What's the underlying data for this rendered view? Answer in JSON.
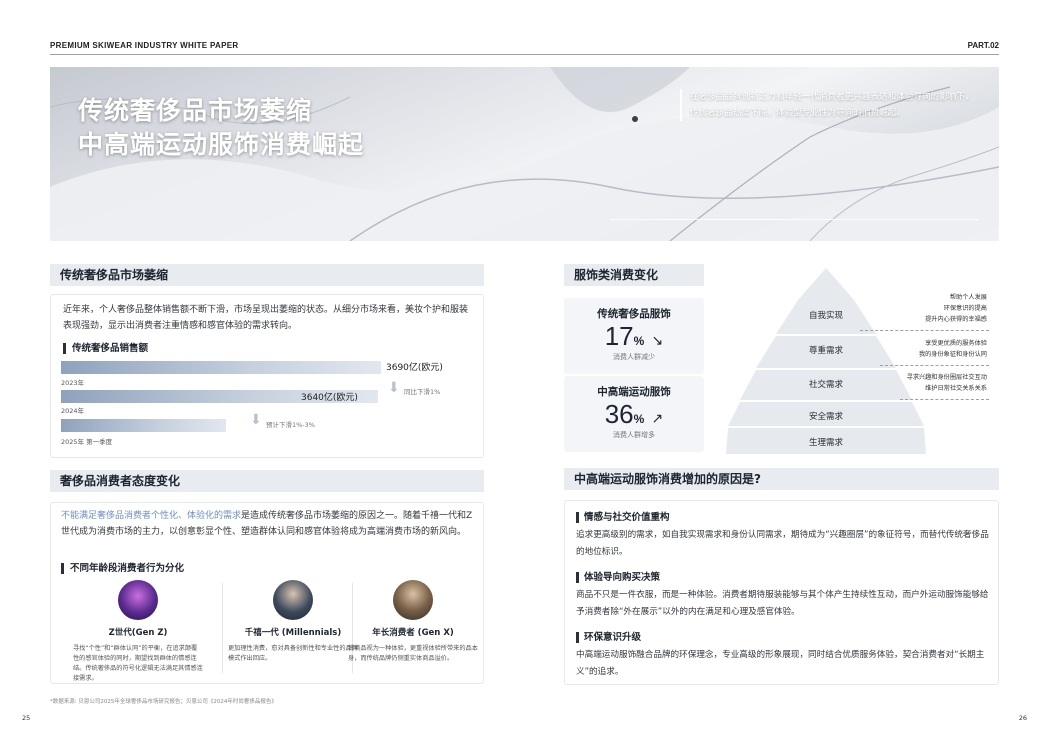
{
  "header": {
    "left": "PREMIUM SKIWEAR INDUSTRY WHITE PAPER",
    "right": "PART.02"
  },
  "hero": {
    "title1": "传统奢侈品市场萎缩",
    "title2": "中高端运动服饰消费崛起",
    "desc": "在奢侈品品牌创新乏力和年轻一代消费者更兴趣表达和体验导向的影响下，传统奢侈品热度下降，体验型专业性为导向的消费崛起。"
  },
  "left_sec1": {
    "title": "传统奢侈品市场萎缩",
    "para": "近年来，个人奢侈品整体销售额不断下滑，市场呈现出萎缩的状态。从细分市场来看，美妆个护和服装表现强劲，显示出消费者注重情感和感官体验的需求转向。",
    "chart_sub": "传统奢侈品销售额"
  },
  "chart_data": {
    "type": "bar",
    "orientation": "horizontal",
    "categories": [
      "2023年",
      "2024年",
      "2025年 第一季度"
    ],
    "values": [
      3690,
      3640,
      null
    ],
    "value_labels": [
      "3690亿(欧元)",
      "3640亿(欧元)",
      ""
    ],
    "annotations": [
      "同比下滑1%",
      "预计下滑1%-3%"
    ]
  },
  "left_sec2": {
    "title": "奢侈品消费者态度变化",
    "para_highlight": "不能满足奢侈品消费者个性化、体验化的需求",
    "para_rest": "是造成传统奢侈品市场萎缩的原因之一。随着千禧一代和Z世代成为消费市场的主力，以创意彰显个性、塑造群体认同和感官体验将成为高端消费市场的新风向。",
    "sub": "不同年龄段消费者行为分化",
    "personas": [
      {
        "name": "Z世代(Gen Z)",
        "desc": "寻找“个性”和“群体认同”的平衡，在追求颠覆性的感官体验的同时，期望找到群体的情感连结。传统奢侈品的符号化逻辑无法满足其情感连接需求。"
      },
      {
        "name": "千禧一代 (Millennials)",
        "desc": "更加理性消费，愈对具备创新性和专业性的品牌模式作出回应。"
      },
      {
        "name": "年长消费者 (Gen X)",
        "desc": "将商品视为一种体验，更重视体验所带来的品本身，而传统品牌仍侧重实体商品溢价。"
      }
    ]
  },
  "right_sec1": {
    "title": "服饰类消费变化",
    "stats": [
      {
        "head": "传统奢侈品服饰",
        "num": "17",
        "unit": "%",
        "cap": "消费人群减少"
      },
      {
        "head": "中高端运动服饰",
        "num": "36",
        "unit": "%",
        "cap": "消费人群增多"
      }
    ],
    "pyramid": [
      "自我实现",
      "尊重需求",
      "社交需求",
      "安全需求",
      "生理需求"
    ],
    "notes": [
      [
        "帮助个人发展",
        "环保意识的提高",
        "提升内心获得的幸福感"
      ],
      [
        "享受更优质的服务体验",
        "我的身份象征和身份认同"
      ],
      [
        "寻求兴趣和身份圈层社交互动",
        "维护日常社交关系关系"
      ]
    ]
  },
  "right_sec2": {
    "title": "中高端运动服饰消费增加的原因是?",
    "reasons": [
      {
        "sub": "情感与社交价值重构",
        "text": "追求更高级别的需求，如自我实现需求和身份认同需求，期待成为“兴趣圈层”的象征符号，而替代传统奢侈品的地位标识。"
      },
      {
        "sub": "体验导向购买决策",
        "text": "商品不只是一件衣服，而是一种体验。消费者期待服装能够与其个体产生持续性互动，而户外运动服饰能够给予消费者除“外在展示”以外的内在满足和心理及感官体验。"
      },
      {
        "sub": "环保意识升级",
        "text": "中高端运动服饰融合品牌的环保理念，专业高级的形象展现，同时结合优质服务体验，契合消费者对“长期主义”的追求。"
      }
    ]
  },
  "footnote": "*数据来源: 贝恩公司2025年全球奢侈品市场研究报告；贝恩公司《2024年时尚奢侈品报告》",
  "pages": {
    "left": "25",
    "right": "26"
  },
  "colors": {
    "highlight_text": "#6d8fc7",
    "section_bg": "#e8ebf0",
    "bar": "#a6b6cc"
  }
}
